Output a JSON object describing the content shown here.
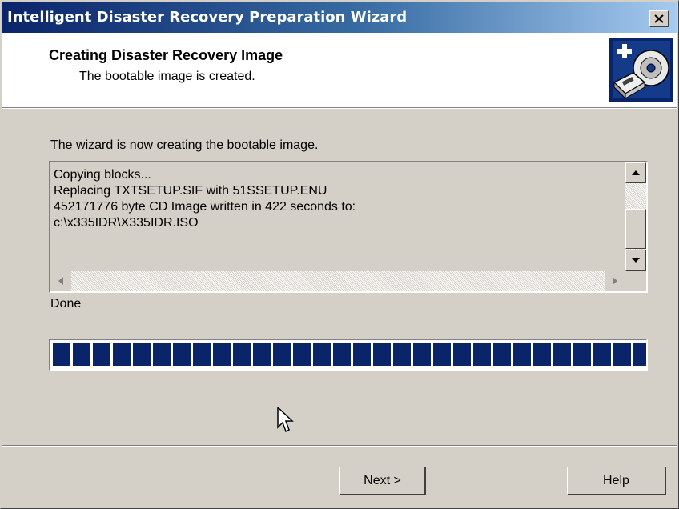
{
  "window": {
    "title": "Intelligent Disaster Recovery Preparation Wizard",
    "close_icon": "close-icon"
  },
  "header": {
    "title": "Creating Disaster Recovery Image",
    "subtitle": "The bootable image is created.",
    "icon": "disaster-recovery-cd-icon"
  },
  "main": {
    "intro_text": "The wizard is now creating the bootable image.",
    "log_lines": [
      "Copying blocks...",
      "Replacing TXTSETUP.SIF with 51SSETUP.ENU",
      "452171776 byte CD Image written in 422 seconds to:",
      "c:\\x335IDR\\X335IDR.ISO"
    ],
    "status_text": "Done",
    "progress_percent": 100
  },
  "buttons": {
    "next_label": "Next >",
    "help_label": "Help"
  },
  "colors": {
    "titlebar_start": "#0a246a",
    "titlebar_end": "#a6caf0",
    "progress_fill": "#0a246a",
    "dialog_face": "#d4d0c8"
  }
}
